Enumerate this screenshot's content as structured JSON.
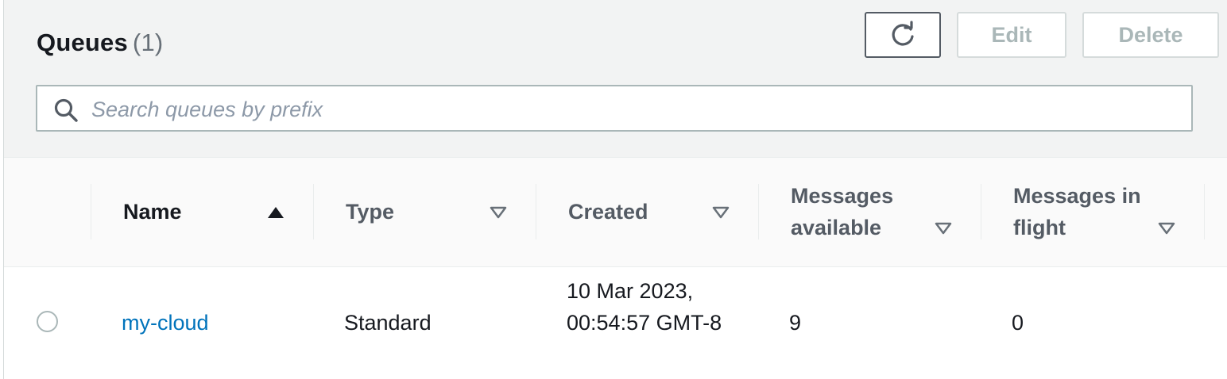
{
  "panel": {
    "title": "Queues",
    "count": "(1)"
  },
  "actions": {
    "refresh_icon": "refresh-icon",
    "edit_label": "Edit",
    "delete_label": "Delete"
  },
  "search": {
    "placeholder": "Search queues by prefix",
    "value": "",
    "icon": "search-icon"
  },
  "table": {
    "columns": [
      {
        "label": "Name",
        "sort": "ascending"
      },
      {
        "label": "Type",
        "sort": "none"
      },
      {
        "label": "Created",
        "sort": "none"
      },
      {
        "label": "Messages available",
        "sort": "none"
      },
      {
        "label": "Messages in flight",
        "sort": "none"
      }
    ],
    "rows": [
      {
        "selected": false,
        "name": "my-cloud",
        "type": "Standard",
        "created": "10 Mar 2023, 00:54:57 GMT-8",
        "messages_available": "9",
        "messages_in_flight": "0"
      }
    ]
  },
  "colors": {
    "link": "#0073bb",
    "text": "#16191f",
    "muted": "#545b64",
    "disabled": "#aab7b8",
    "header_bg": "#f2f3f3"
  }
}
